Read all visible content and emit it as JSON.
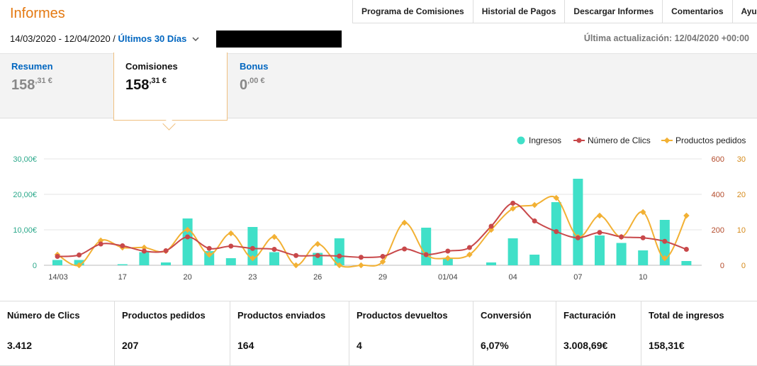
{
  "header": {
    "title": "Informes"
  },
  "nav": [
    "Programa de Comisiones",
    "Historial de Pagos",
    "Descargar Informes",
    "Comentarios",
    "Ayuda"
  ],
  "date_range": {
    "range": "14/03/2020 - 12/04/2020 /",
    "preset": "Últimos 30 Días"
  },
  "last_updated": "Última actualización: 12/04/2020 +00:00",
  "summary": [
    {
      "label": "Resumen",
      "int": "158",
      "dec": ",31",
      "cur": " €"
    },
    {
      "label": "Comisiones",
      "int": "158",
      "dec": ",31",
      "cur": " €"
    },
    {
      "label": "Bonus",
      "int": "0",
      "dec": ",00",
      "cur": " €"
    }
  ],
  "colors": {
    "bars": "#40e0c8",
    "clicks": "#c8484a",
    "orders": "#f2b134",
    "link": "#0066c0",
    "title": "#e47911"
  },
  "chart_data": {
    "type": "bar",
    "legend": [
      "Ingresos",
      "Número de Clics",
      "Productos pedidos"
    ],
    "legend_position": "top-right",
    "x_ticks": [
      "14/03",
      "17",
      "20",
      "23",
      "26",
      "29",
      "01/04",
      "04",
      "07",
      "10"
    ],
    "x_tick_index": [
      0,
      3,
      6,
      9,
      12,
      15,
      18,
      21,
      24,
      27
    ],
    "left_axis": {
      "ticks": [
        "0",
        "10,00€",
        "20,00€",
        "30,00€"
      ],
      "ylim": [
        0,
        30
      ]
    },
    "right_axis_1": {
      "ticks": [
        "0",
        "200",
        "400",
        "600"
      ],
      "ylim": [
        0,
        600
      ]
    },
    "right_axis_2": {
      "ticks": [
        "0",
        "10",
        "20",
        "30"
      ],
      "ylim": [
        0,
        30
      ]
    },
    "ingresos": [
      1.5,
      1.5,
      0,
      0.3,
      3.7,
      0.8,
      13.2,
      4,
      2,
      10.8,
      3.7,
      0,
      3.5,
      7.6,
      0,
      0,
      0,
      10.6,
      2,
      0,
      0.8,
      7.6,
      3,
      17.8,
      24.4,
      8.4,
      6.3,
      4.2,
      12.8,
      1.2
    ],
    "clicks": [
      50,
      58,
      120,
      110,
      80,
      82,
      160,
      95,
      108,
      95,
      90,
      55,
      55,
      52,
      45,
      50,
      92,
      60,
      80,
      100,
      220,
      350,
      250,
      190,
      155,
      185,
      160,
      155,
      135,
      90
    ],
    "orders": [
      3,
      0,
      7,
      5,
      5,
      4,
      10,
      3,
      9,
      2,
      8,
      0,
      6,
      0,
      0,
      1,
      12,
      3,
      2,
      3,
      10,
      16,
      17,
      19,
      8,
      14,
      8,
      15,
      2,
      14
    ]
  },
  "metrics": [
    {
      "label": "Número de Clics",
      "value": "3.412"
    },
    {
      "label": "Productos pedidos",
      "value": "207"
    },
    {
      "label": "Productos enviados",
      "value": "164"
    },
    {
      "label": "Productos devueltos",
      "value": "4"
    },
    {
      "label": "Conversión",
      "value": "6,07%"
    },
    {
      "label": "Facturación",
      "value": "3.008,69€"
    },
    {
      "label": "Total de ingresos",
      "value": "158,31€"
    }
  ]
}
